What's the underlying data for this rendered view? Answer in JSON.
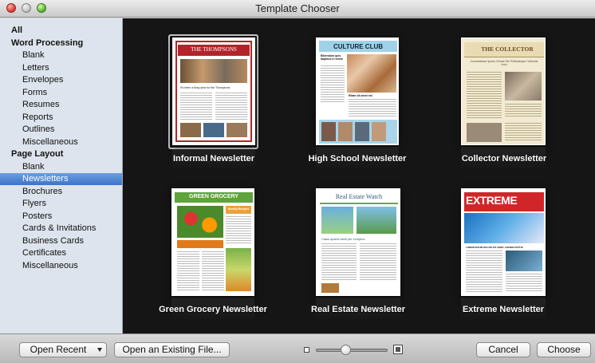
{
  "window": {
    "title": "Template Chooser"
  },
  "sidebar": {
    "items": [
      {
        "label": "All",
        "kind": "cat"
      },
      {
        "label": "Word Processing",
        "kind": "cat"
      },
      {
        "label": "Blank",
        "kind": "sub"
      },
      {
        "label": "Letters",
        "kind": "sub"
      },
      {
        "label": "Envelopes",
        "kind": "sub"
      },
      {
        "label": "Forms",
        "kind": "sub"
      },
      {
        "label": "Resumes",
        "kind": "sub"
      },
      {
        "label": "Reports",
        "kind": "sub"
      },
      {
        "label": "Outlines",
        "kind": "sub"
      },
      {
        "label": "Miscellaneous",
        "kind": "sub"
      },
      {
        "label": "Page Layout",
        "kind": "cat"
      },
      {
        "label": "Blank",
        "kind": "sub"
      },
      {
        "label": "Newsletters",
        "kind": "sub",
        "selected": true
      },
      {
        "label": "Brochures",
        "kind": "sub"
      },
      {
        "label": "Flyers",
        "kind": "sub"
      },
      {
        "label": "Posters",
        "kind": "sub"
      },
      {
        "label": "Cards & Invitations",
        "kind": "sub"
      },
      {
        "label": "Business Cards",
        "kind": "sub"
      },
      {
        "label": "Certificates",
        "kind": "sub"
      },
      {
        "label": "Miscellaneous",
        "kind": "sub"
      }
    ]
  },
  "templates": [
    {
      "label": "Informal Newsletter",
      "heading": "THE THOMPSONS",
      "subheading": "It's been a busy year for the Thompsons",
      "selected": true
    },
    {
      "label": "High School Newsletter",
      "heading": "CULTURE CLUB",
      "subheading": "Bibendum quis dapibus in lorem",
      "headline2": "Etiam sit amet est"
    },
    {
      "label": "Collector Newsletter",
      "heading": "THE COLLECTOR",
      "subheading": "Consectetuer Ipsum Ornare Dis Pellentesque Vehicula Arcu"
    },
    {
      "label": "Green Grocery Newsletter",
      "heading": "GREEN GROCERY",
      "subheading": "Weekly Recipes"
    },
    {
      "label": "Real Estate Newsletter",
      "heading": "Real Estate Watch",
      "subheading": "Class aptent taciti per inceptos"
    },
    {
      "label": "Extreme Newsletter",
      "heading": "EXTREME",
      "subheading": "LOREM IPSUM DOLOR SIT AMET, CONSECTETUR"
    }
  ],
  "toolbar": {
    "open_recent": "Open Recent",
    "open_existing": "Open an Existing File...",
    "cancel": "Cancel",
    "choose": "Choose"
  },
  "zoom": {
    "level": 0.42
  },
  "colors": {
    "selection": "#3d74c9",
    "sidebar_bg": "#dde4ed",
    "browser_bg": "#151515"
  }
}
